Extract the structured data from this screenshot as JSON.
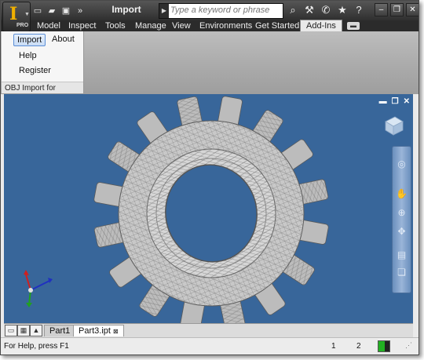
{
  "app": {
    "badge_text": "PRO",
    "window_title": "Import"
  },
  "search": {
    "placeholder": "Type a keyword or phrase"
  },
  "ribbon": {
    "tabs": [
      "Model",
      "Inspect",
      "Tools",
      "Manage",
      "View",
      "Environments",
      "Get Started",
      "Add-Ins"
    ],
    "active_tab": "Add-Ins",
    "panel": {
      "buttons": [
        "Import",
        "About",
        "Help",
        "Register"
      ],
      "title": "OBJ Import for Inventor"
    }
  },
  "viewport": {
    "background": "#38669a",
    "model": "gear",
    "controls": [
      "minimize-icon",
      "restore-icon",
      "close-icon"
    ]
  },
  "document_tabs": {
    "tabs": [
      "Part1",
      "Part3.ipt"
    ],
    "active": "Part3.ipt"
  },
  "statusbar": {
    "help_text": "For Help, press F1",
    "counter_1": "1",
    "counter_2": "2",
    "memory_color": "#22b022"
  }
}
